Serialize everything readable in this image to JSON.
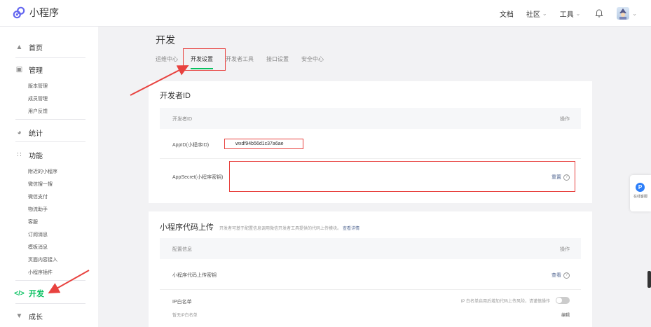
{
  "header": {
    "logo_text": "小程序",
    "nav": {
      "docs": "文档",
      "community": "社区",
      "tools": "工具"
    }
  },
  "sidebar": {
    "home": "首页",
    "manage": "管理",
    "manage_items": [
      "版本管理",
      "成员管理",
      "用户反馈"
    ],
    "stats": "统计",
    "features": "功能",
    "feature_items": [
      "附近的小程序",
      "微信搜一搜",
      "微信支付",
      "物流助手",
      "客服",
      "订阅消息",
      "模板消息",
      "页面内容接入",
      "小程序插件"
    ],
    "dev": "开发",
    "grow": "成长"
  },
  "main": {
    "title": "开发",
    "tabs": [
      "运维中心",
      "开发设置",
      "开发者工具",
      "接口设置",
      "安全中心"
    ],
    "dev_id_section": {
      "title": "开发者ID",
      "col_left": "开发者ID",
      "col_right": "操作",
      "appid_label": "AppID(小程序ID)",
      "appid_value": "wxdf94b56d1c37a6ae",
      "secret_label": "AppSecret(小程序密钥)",
      "secret_action": "重置"
    },
    "upload_section": {
      "title": "小程序代码上传",
      "desc": "开发者可基于配置信息调用微信开发者工具提供的代码上传模块。",
      "desc_link": "查看详情",
      "col_left": "配置信息",
      "col_right": "操作",
      "key_label": "小程序代码上传密钥",
      "key_action": "查看",
      "ip_label": "IP白名单",
      "ip_hint": "IP 白名单启用后增加代码上传风险，请谨慎操作",
      "ip_empty": "暂无IP白名单",
      "ip_edit": "编辑"
    }
  },
  "float_help": {
    "text": "在线客服"
  },
  "colors": {
    "accent": "#07c160",
    "annotation": "#e8423f",
    "link": "#576b95"
  }
}
